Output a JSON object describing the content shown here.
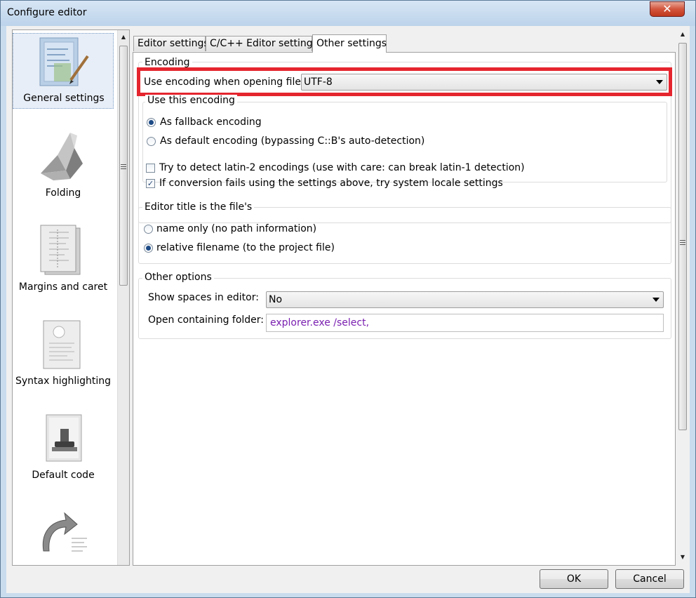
{
  "window": {
    "title": "Configure editor",
    "close_glyph": "✕"
  },
  "categories": [
    {
      "label": "General settings",
      "icon": "general-settings-icon"
    },
    {
      "label": "Folding",
      "icon": "folding-icon"
    },
    {
      "label": "Margins and caret",
      "icon": "margins-icon"
    },
    {
      "label": "Syntax highlighting",
      "icon": "syntax-highlighting-icon"
    },
    {
      "label": "Default code",
      "icon": "default-code-icon"
    },
    {
      "label": "",
      "icon": "abbreviations-icon"
    }
  ],
  "tabs": [
    {
      "label": "Editor settings"
    },
    {
      "label": "C/C++ Editor settings"
    },
    {
      "label": "Other settings"
    }
  ],
  "encoding": {
    "group_label": "Encoding",
    "use_label": "Use encoding when opening files:",
    "value": "UTF-8",
    "use_this_label": "Use this encoding",
    "fallback_label": "As fallback encoding",
    "default_label": "As default encoding (bypassing C::B's auto-detection)",
    "latin2_label": "Try to detect latin-2 encodings (use with care: can break latin-1 detection)",
    "locale_label": "If conversion fails using the settings above, try system locale settings"
  },
  "title_group": {
    "label": "Editor title is the file's",
    "name_only": "name only (no path information)",
    "relative": "relative filename (to the project file)"
  },
  "other_options": {
    "label": "Other options",
    "show_spaces_label": "Show spaces in editor:",
    "show_spaces_value": "No",
    "open_folder_label": "Open containing folder:",
    "open_folder_value": "explorer.exe /select,"
  },
  "buttons": {
    "ok": "OK",
    "cancel": "Cancel"
  },
  "colors": {
    "highlight": "#e5252e",
    "radio_dot": "#1c4a86",
    "input_text": "#7a1fb0"
  }
}
